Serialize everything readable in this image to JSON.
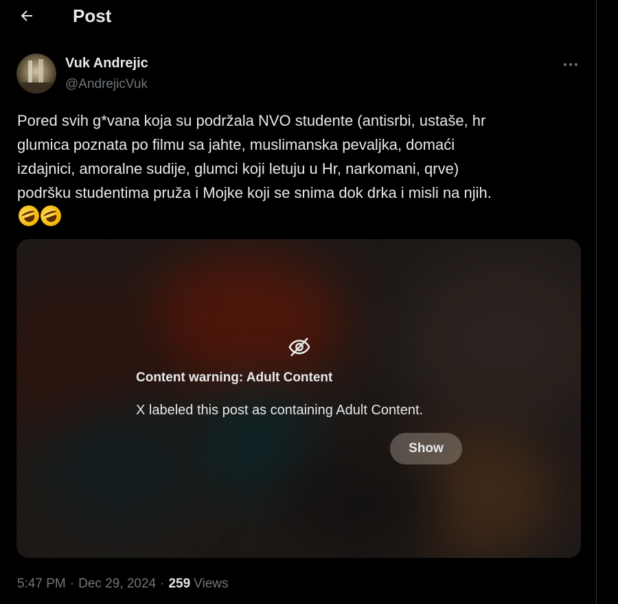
{
  "header": {
    "title": "Post",
    "back_icon": "arrow-left-icon"
  },
  "author": {
    "name": "Vuk Andrejic",
    "handle": "@AndrejicVuk"
  },
  "post": {
    "text": "Pored svih g*vana koja su podržala NVO studente (antisrbi, ustaše, hr\nglumica poznata po filmu sa jahte, muslimanska pevaljka, domaći\nizdajnici, amoralne sudije, glumci koji letuju u Hr, narkomani, qrve)\npodršku studentima pruža i Mojke koji se snima dok drka i misli na njih.",
    "emojis": [
      "rolling-on-floor-laughing-emoji",
      "rolling-on-floor-laughing-emoji"
    ]
  },
  "media": {
    "warning_icon": "eye-slash-icon",
    "warning_title": "Content warning: Adult Content",
    "warning_text": "X labeled this post as containing Adult Content.",
    "show_label": "Show"
  },
  "meta": {
    "time": "5:47 PM",
    "separator": "·",
    "date": "Dec 29, 2024",
    "views_count": "259",
    "views_label": "Views"
  },
  "colors": {
    "background": "#000000",
    "text_primary": "#e7e9ea",
    "text_secondary": "#71767b",
    "border": "#2f3336"
  }
}
